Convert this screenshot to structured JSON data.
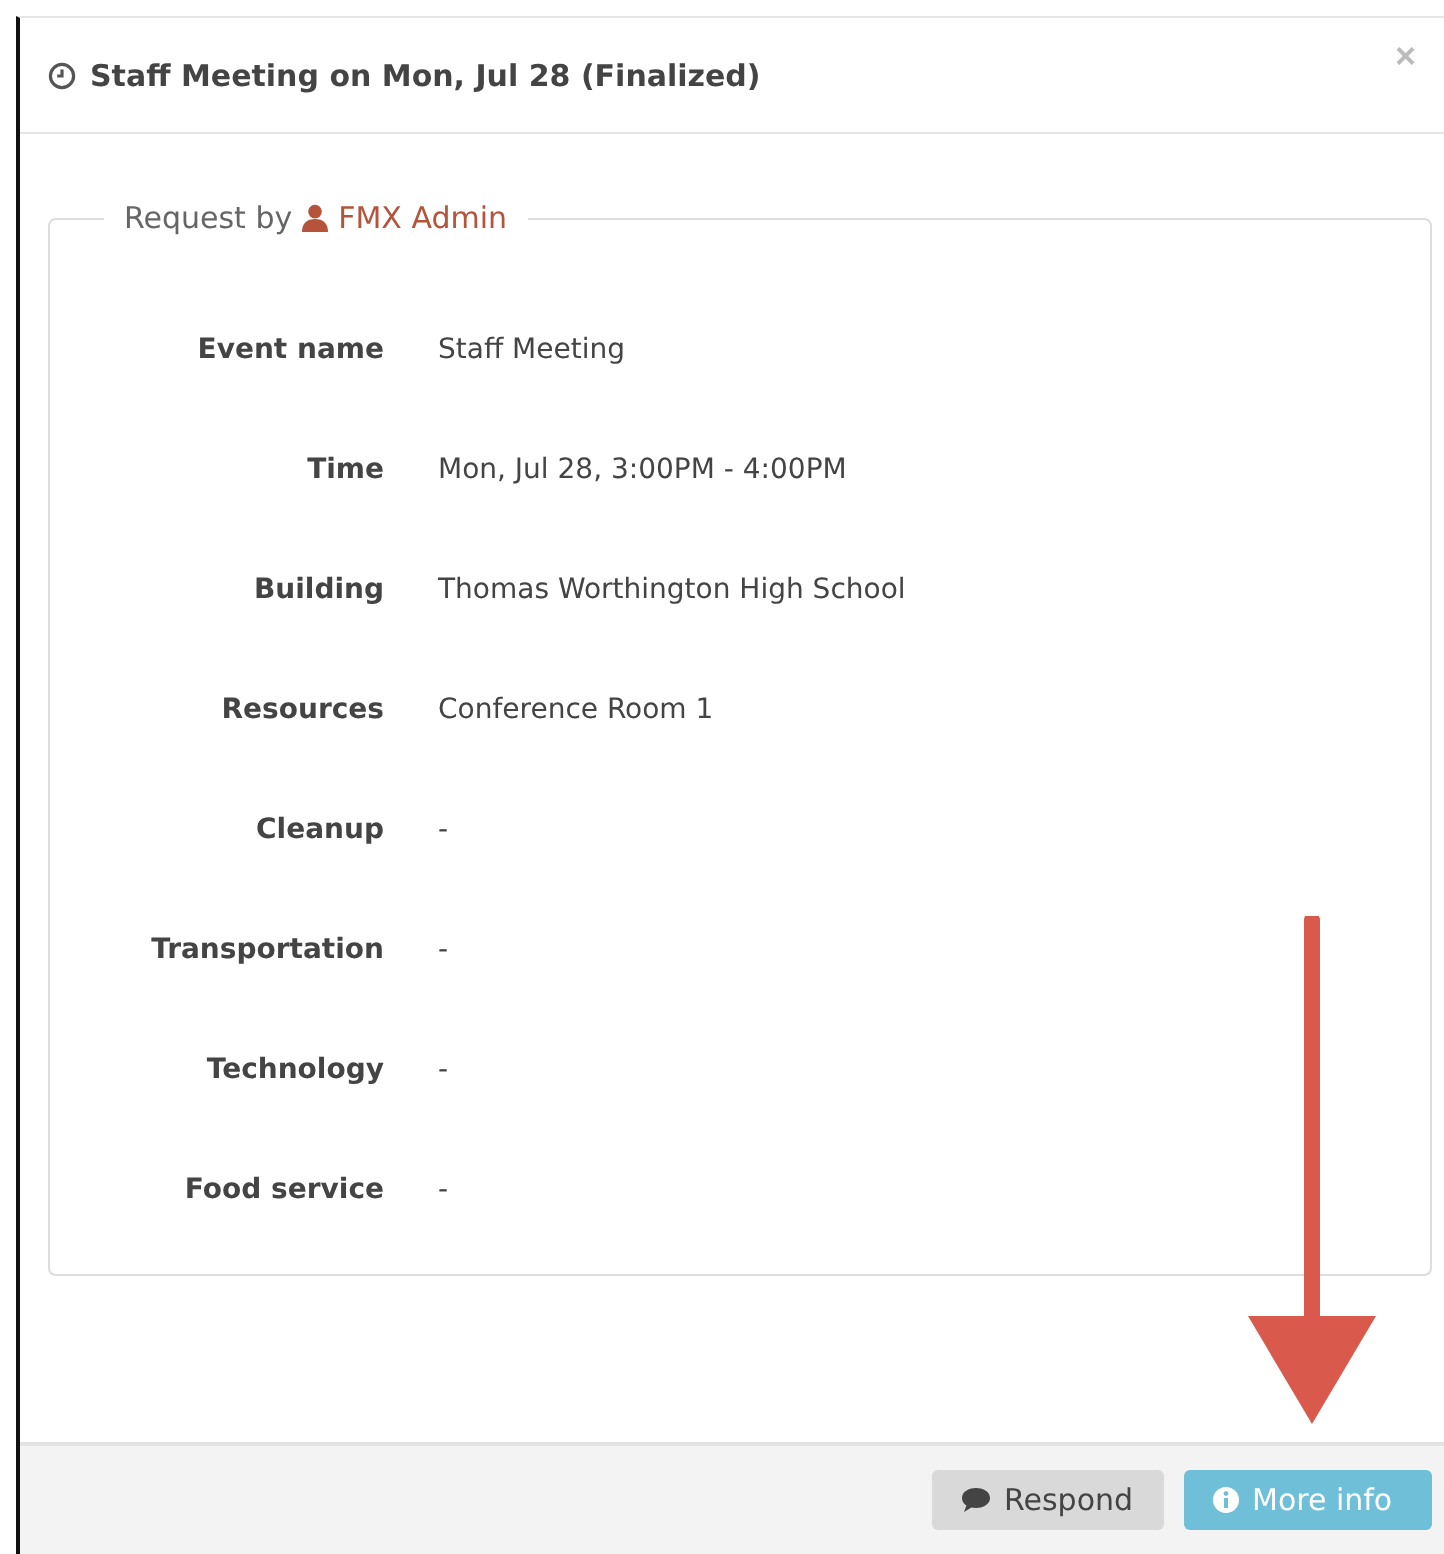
{
  "dialog": {
    "title": "Staff Meeting on Mon, Jul 28 (Finalized)",
    "close": "×"
  },
  "request": {
    "prefix": "Request by",
    "requester": "FMX Admin"
  },
  "fields": [
    {
      "label": "Event name",
      "value": "Staff Meeting"
    },
    {
      "label": "Time",
      "value": "Mon, Jul 28, 3:00PM - 4:00PM"
    },
    {
      "label": "Building",
      "value": "Thomas Worthington High School"
    },
    {
      "label": "Resources",
      "value": "Conference Room 1"
    },
    {
      "label": "Cleanup",
      "value": "-"
    },
    {
      "label": "Transportation",
      "value": "-"
    },
    {
      "label": "Technology",
      "value": "-"
    },
    {
      "label": "Food service",
      "value": "-"
    }
  ],
  "buttons": [
    {
      "kind": "respond",
      "label": "Respond"
    },
    {
      "kind": "info",
      "label": "More info"
    }
  ]
}
